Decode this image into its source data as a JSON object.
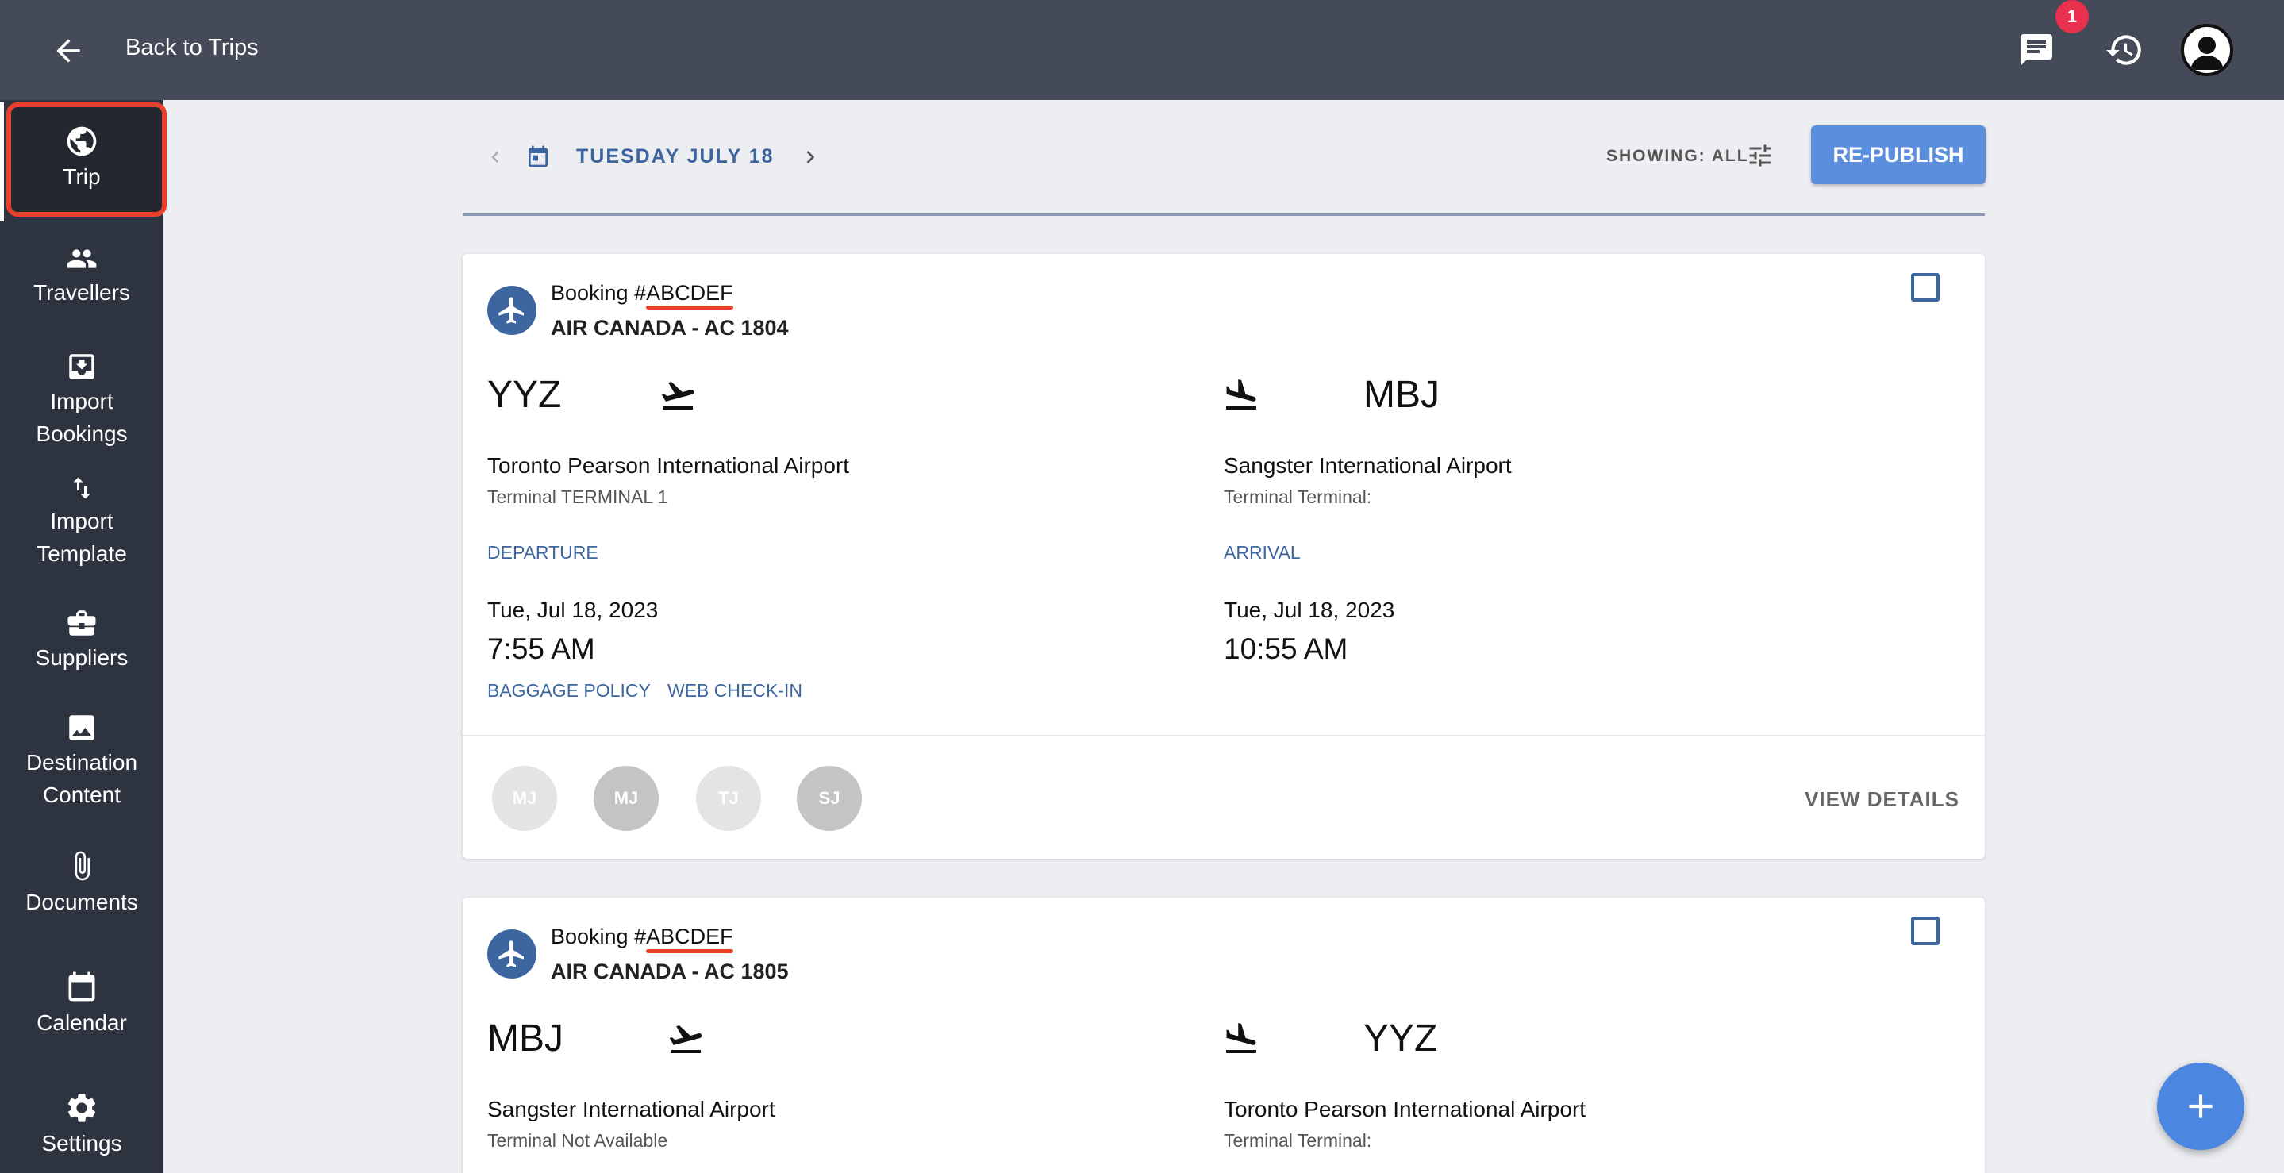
{
  "header": {
    "back_label": "Back to Trips",
    "notification_count": "1"
  },
  "sidebar": {
    "items": [
      {
        "label": "Trip",
        "icon": "globe-icon"
      },
      {
        "label": "Travellers",
        "icon": "people-icon"
      },
      {
        "label": "Import\nBookings",
        "icon": "import-icon"
      },
      {
        "label": "Import\nTemplate",
        "icon": "swap-vertical-icon"
      },
      {
        "label": "Suppliers",
        "icon": "briefcase-icon"
      },
      {
        "label": "Destination\nContent",
        "icon": "image-icon"
      },
      {
        "label": "Documents",
        "icon": "paperclip-icon"
      },
      {
        "label": "Calendar",
        "icon": "calendar-icon"
      },
      {
        "label": "Settings",
        "icon": "gear-icon"
      }
    ]
  },
  "datebar": {
    "date": "TUESDAY JULY 18",
    "showing": "SHOWING: ALL",
    "republish": "RE-PUBLISH"
  },
  "bookings": [
    {
      "title_prefix": "Booking #",
      "code": "ABCDEF",
      "airline": "AIR CANADA - AC 1804",
      "origin": {
        "code": "YYZ",
        "airport": "Toronto Pearson International Airport",
        "terminal": "Terminal TERMINAL 1",
        "label": "DEPARTURE",
        "date": "Tue, Jul 18, 2023",
        "time": "7:55 AM"
      },
      "destination": {
        "code": "MBJ",
        "airport": "Sangster International Airport",
        "terminal": "Terminal Terminal:",
        "label": "ARRIVAL",
        "date": "Tue, Jul 18, 2023",
        "time": "10:55 AM"
      },
      "links": [
        "BAGGAGE POLICY",
        "WEB CHECK-IN"
      ],
      "travellers": [
        "MJ",
        "MJ",
        "TJ",
        "SJ"
      ],
      "view_details": "VIEW DETAILS"
    },
    {
      "title_prefix": "Booking #",
      "code": "ABCDEF",
      "airline": "AIR CANADA - AC 1805",
      "origin": {
        "code": "MBJ",
        "airport": "Sangster International Airport",
        "terminal": "Terminal Not Available"
      },
      "destination": {
        "code": "YYZ",
        "airport": "Toronto Pearson International Airport",
        "terminal": "Terminal Terminal:"
      }
    }
  ],
  "colors": {
    "topbar": "#444a58",
    "sidebar": "#2e3340",
    "accent": "#3d65a0",
    "button": "#5b8fde",
    "highlight": "#e8402a"
  }
}
